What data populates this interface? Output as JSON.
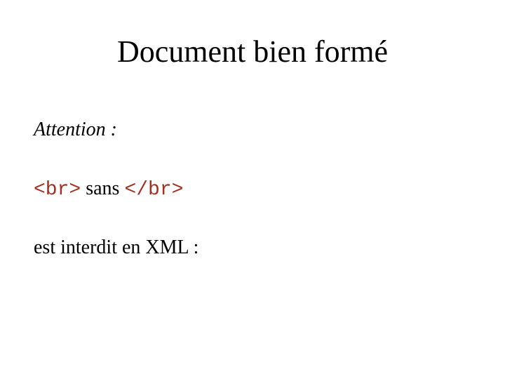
{
  "title": "Document bien formé",
  "attention": "Attention :",
  "code_open": "<br>",
  "sans": " sans ",
  "code_close": "</br>",
  "xml_line": "est interdit en XML :"
}
